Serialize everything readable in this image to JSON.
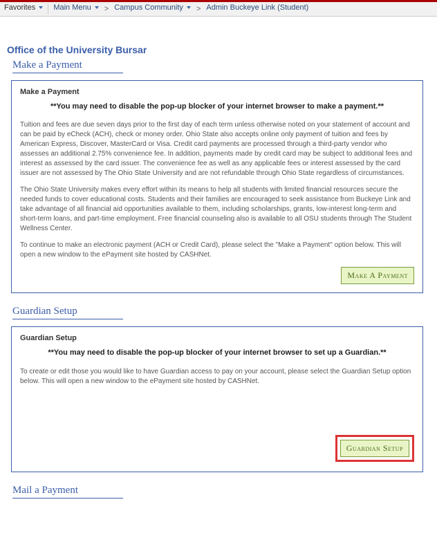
{
  "breadcrumb": {
    "favorites": "Favorites",
    "items": [
      "Main Menu",
      "Campus Community",
      "Admin Buckeye Link (Student)"
    ]
  },
  "page_title": "Office of the University Bursar",
  "sections": {
    "make_payment": {
      "heading": "Make a Payment",
      "panel_title": "Make a Payment",
      "popup_warning": "**You may need to disable the pop-up blocker of your internet browser to make a payment.**",
      "para1": "Tuition and fees are due seven days prior to the first day of each term unless otherwise noted on your statement of account and can be paid by eCheck (ACH), check or money order. Ohio State also accepts online only payment of tuition and fees by American Express, Discover, MasterCard or Visa. Credit card payments are processed through a third-party vendor who assesses an additional 2.75% convenience fee. In addition, payments made by credit card may be subject to additional fees and interest as assessed by the card issuer. The convenience fee as well as any applicable fees or interest assessed by the card issuer are not assessed by The Ohio State University and are not refundable through Ohio State regardless of circumstances.",
      "para2": "The Ohio State University makes every effort within its means to help all students with limited financial resources secure the needed funds to cover educational costs. Students and their families are encouraged to seek assistance from Buckeye Link and take advantage of all financial aid opportunities available to them, including scholarships, grants, low-interest long-term and short-term loans, and part-time employment. Free financial counseling also is available to all OSU students through The Student Wellness Center.",
      "para3": "To continue to make an electronic payment (ACH or Credit Card), please select the \"Make a Payment\" option below. This will open a new window to the ePayment site hosted by CASHNet.",
      "button": "Make A Payment"
    },
    "guardian": {
      "heading": "Guardian Setup",
      "panel_title": "Guardian Setup",
      "popup_warning": "**You may need to disable the pop-up blocker of your internet browser to set up a Guardian.**",
      "para1": "To create or edit those you would like to have Guardian access to pay on your account, please select the Guardian Setup option below. This will open a new window to the ePayment site hosted by CASHNet.",
      "button": "Guardian Setup"
    },
    "mail": {
      "heading": "Mail a Payment"
    }
  }
}
